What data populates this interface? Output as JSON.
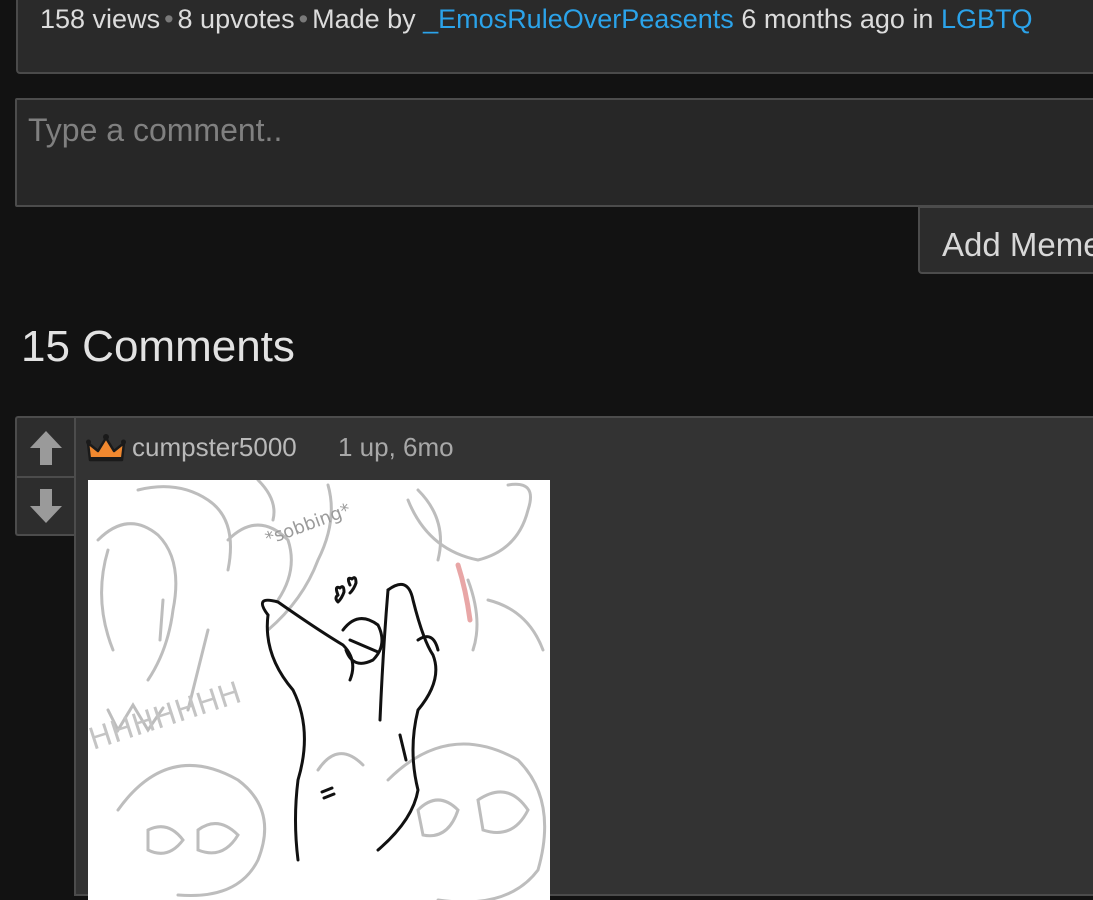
{
  "meta": {
    "views": "158 views",
    "upvotes": "8 upvotes",
    "made_by_prefix": "Made by",
    "author": "_EmosRuleOverPeasents",
    "time_ago": "6 months ago in",
    "stream": "LGBTQ",
    "link_color": "#2ba3ea"
  },
  "comment_form": {
    "placeholder": "Type a comment..",
    "value": "",
    "add_meme_label": "Add Meme"
  },
  "comments_section": {
    "heading": "15 Comments"
  },
  "comments": [
    {
      "badge_icon": "crown-icon",
      "badge_color": "#f0882f",
      "username": "cumpster5000",
      "stats": "1 up, 6mo",
      "image_text": [
        "*sobbing*",
        "HHHHHHH"
      ]
    }
  ]
}
